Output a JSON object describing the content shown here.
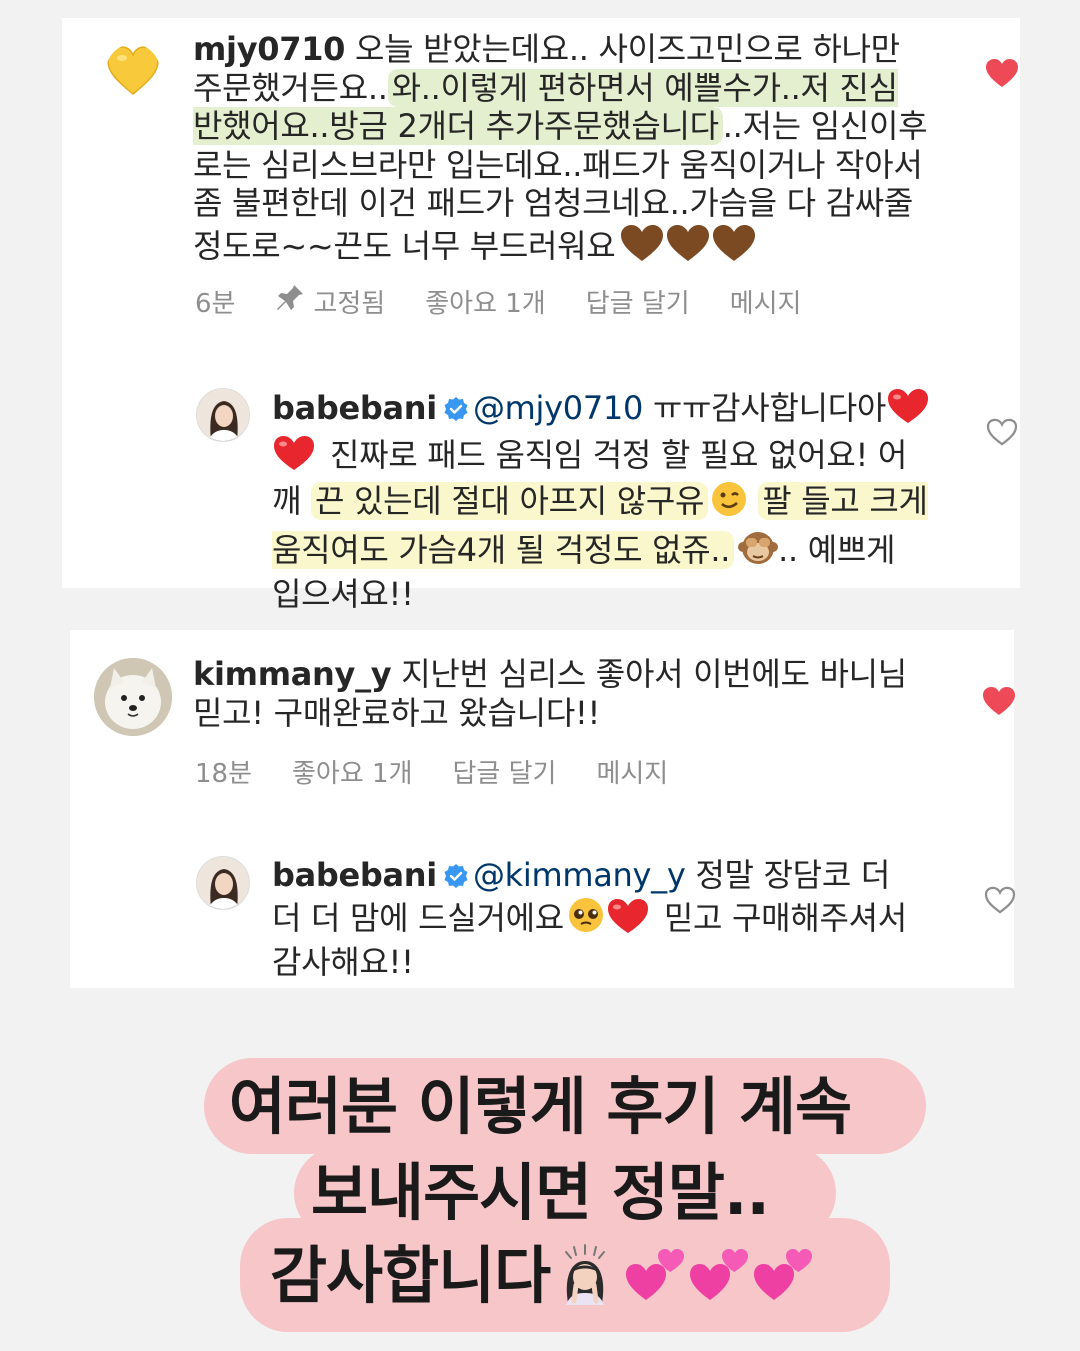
{
  "comments": [
    {
      "username": "mjy0710",
      "text_part1": "오늘 받았는데요.. 사이즈고민으로 하나만 주문했거든요..",
      "text_highlight": "와..이렇게 편하면서 예쁠수가..저 진심 반했어요..방금 2개더 추가주문했습니다",
      "text_part2": "..저는 임신이후로는 심리스브라만 입는데요..패드가 움직이거나 작아서 좀 불편한데 이건 패드가 엄청크네요..가슴을 다 감싸줄 정도로~~끈도 너무 부드러워요",
      "time": "6분",
      "pinned_label": "고정됨",
      "likes": "좋아요 1개",
      "reply_label": "답글 달기",
      "message_label": "메시지",
      "liked": true
    },
    {
      "username": "kimmany_y",
      "text": "지난번 심리스 좋아서 이번에도 바니님 믿고! 구매완료하고 왔습니다!!",
      "time": "18분",
      "likes": "좋아요 1개",
      "reply_label": "답글 달기",
      "message_label": "메시지",
      "liked": true
    }
  ],
  "replies": [
    {
      "username": "babebani",
      "mention": "@mjy0710",
      "text_part1": "ㅠㅠ감사합니다아",
      "text_part2": "진짜로 패드 움직임 걱정 할 필요 없어요! 어깨",
      "text_highlight": "끈 있는데 절대 아프지 않구유",
      "text_highlight2": "팔 들고 크게 움직여도 가슴4개 될 걱정도 없쥬..",
      "text_part3": ".. 예쁘게 입으셔요!!",
      "liked": false
    },
    {
      "username": "babebani",
      "mention": "@kimmany_y",
      "text_part1": "정말 장담코 더 더 더 맘에 드실거에요",
      "text_part2": "믿고 구매해주셔서 감사해요!!",
      "liked": false
    }
  ],
  "banner": {
    "line1": "여러분 이렇게 후기 계속",
    "line2": "보내주시면 정말..",
    "line3": "감사합니다"
  },
  "colors": {
    "liked_heart": "#ed4956",
    "highlight_green": "#e4efcf",
    "highlight_yellow": "#fbf7cc",
    "banner_pink": "#f7c6c9",
    "mention_blue": "#00376b"
  },
  "icons": [
    "yellow-heart-icon",
    "brown-heart-icon",
    "pin-icon",
    "verified-badge-icon",
    "red-heart-icon",
    "outline-heart-icon",
    "winking-face-icon",
    "see-no-evil-monkey-icon",
    "pleading-face-icon",
    "person-bowing-icon",
    "two-hearts-icon"
  ]
}
